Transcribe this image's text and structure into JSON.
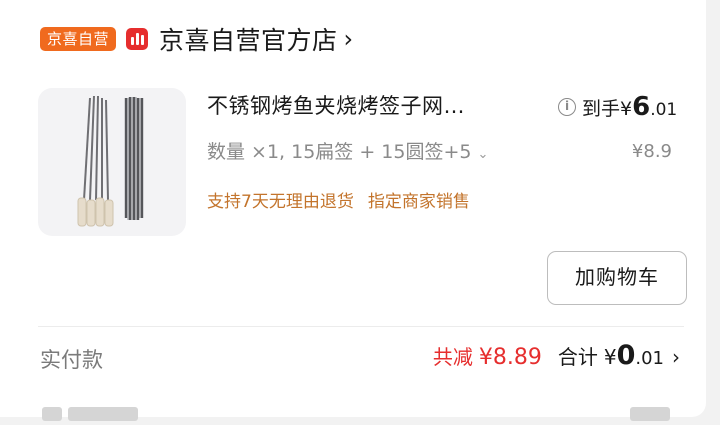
{
  "store": {
    "badge": "京喜自营",
    "icon": "bar-chart-icon",
    "name": "京喜自营官方店",
    "chevron": "›"
  },
  "product": {
    "image": "skewers-product-image",
    "title": "不锈钢烤鱼夹烧烤签子网…",
    "spec": "数量 ×1, 15扁签 + 15圆签+5",
    "spec_chevron": "⌄",
    "services": [
      "支持7天无理由退货",
      "指定商家销售"
    ],
    "price_label": "到手",
    "price_currency": "¥",
    "price_int": "6",
    "price_dec": ".01",
    "original_price": "¥8.9",
    "add_to_cart": "加购物车"
  },
  "payment": {
    "label": "实付款",
    "saved_label": "共减",
    "saved_amount": "¥8.89",
    "total_label": "合计",
    "total_currency": "¥",
    "total_int": "0",
    "total_dec": ".01",
    "chevron": "›"
  },
  "colors": {
    "badge": "#f06a1e",
    "store_icon": "#e62e2e",
    "service_text": "#c3742c",
    "saved_red": "#e62e2e"
  }
}
